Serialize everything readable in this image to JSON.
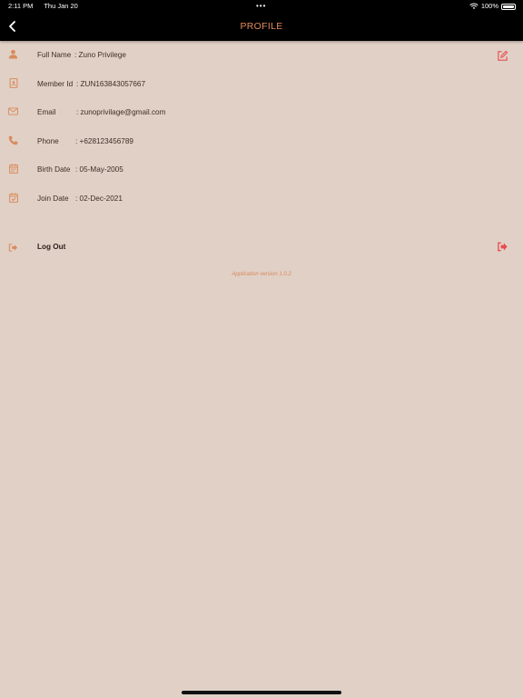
{
  "status_bar": {
    "time": "2:11 PM",
    "date": "Thu Jan 20",
    "dots": "•••",
    "battery": "100%"
  },
  "nav": {
    "title": "PROFILE",
    "back_icon": "chevron-left-icon"
  },
  "profile": {
    "rows": [
      {
        "icon": "user-icon",
        "label": "Full Name",
        "value": ": Zuno Privilege"
      },
      {
        "icon": "member-card-icon",
        "label": "Member Id",
        "value": ": ZUN163843057667"
      },
      {
        "icon": "envelope-icon",
        "label": "Email",
        "value": ": zunoprivilage@gmail.com"
      },
      {
        "icon": "phone-icon",
        "label": "Phone",
        "value": ": +628123456789"
      },
      {
        "icon": "calendar-icon",
        "label": "Birth Date",
        "value": ": 05-May-2005"
      },
      {
        "icon": "calendar-check-icon",
        "label": "Join Date",
        "value": ": 02-Dec-2021"
      }
    ],
    "edit_icon": "edit-icon"
  },
  "logout": {
    "label": "Log Out",
    "icon": "logout-icon"
  },
  "app_version": "Application version 1.0.2",
  "colors": {
    "background": "#e1d0c5",
    "nav_background": "#000000",
    "accent": "#e28a5a",
    "icon": "#d98a5c",
    "logout_accent": "#e84a52"
  }
}
